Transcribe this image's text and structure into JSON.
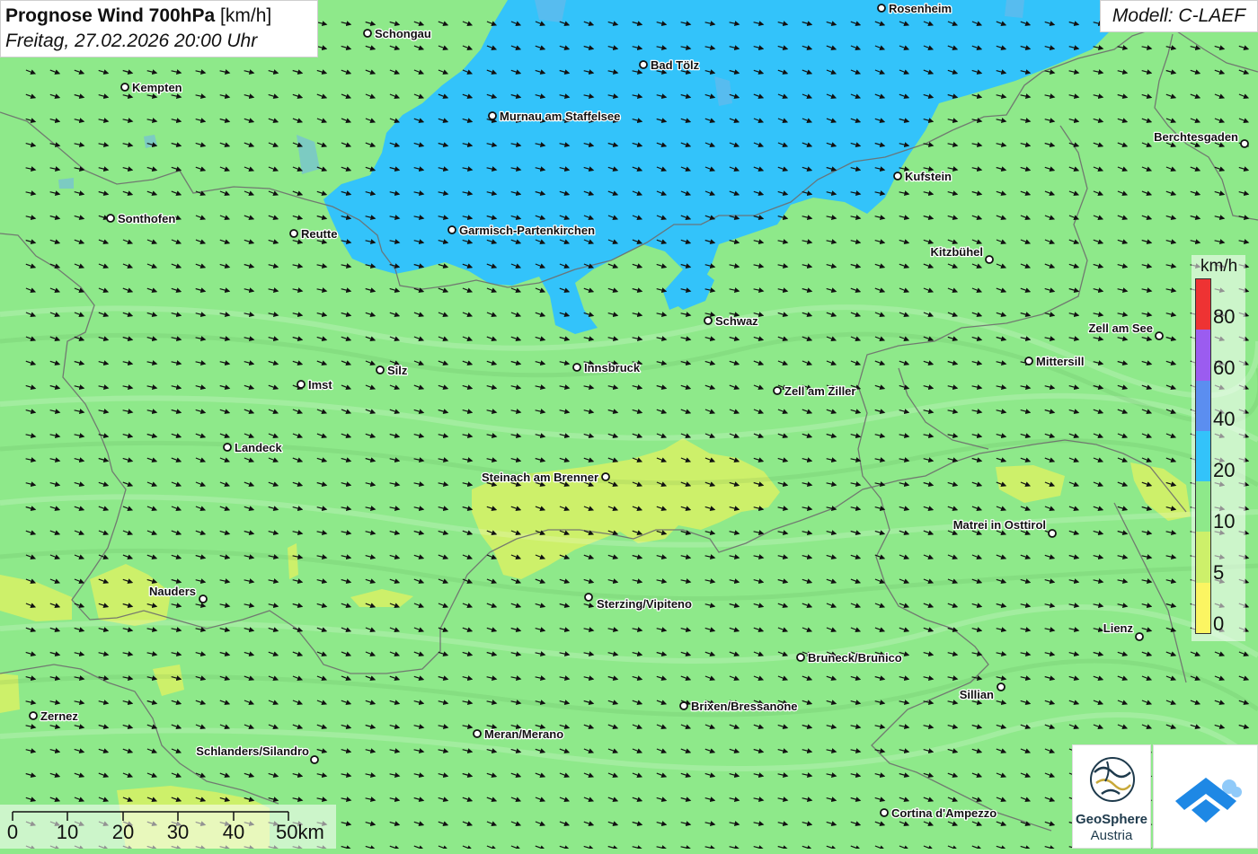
{
  "header": {
    "title_bold": "Prognose Wind 700hPa",
    "title_unit": "[km/h]",
    "subtitle": "Freitag, 27.02.2026 20:00 Uhr",
    "model": "Modell: C-LAEF"
  },
  "legend": {
    "unit": "km/h",
    "segments": [
      {
        "color": "#ee3333"
      },
      {
        "color": "#9b5cf0"
      },
      {
        "color": "#5b8ef0"
      },
      {
        "color": "#33c3fa"
      },
      {
        "color": "#8ee98a"
      },
      {
        "color": "#cdf06a"
      },
      {
        "color": "#fbf562"
      }
    ],
    "ticks": [
      "80",
      "60",
      "40",
      "20",
      "10",
      "5",
      "0"
    ]
  },
  "scale_bar": {
    "ticks": [
      "0",
      "10",
      "20",
      "30",
      "40",
      "50km"
    ]
  },
  "cities": [
    {
      "id": "rosenheim",
      "name": "Rosenheim",
      "label_side": "right"
    },
    {
      "id": "schongau",
      "name": "Schongau",
      "label_side": "right"
    },
    {
      "id": "bad-toelz",
      "name": "Bad Tölz",
      "label_side": "right"
    },
    {
      "id": "kempten",
      "name": "Kempten",
      "label_side": "right"
    },
    {
      "id": "murnau",
      "name": "Murnau am Staffelsee",
      "label_side": "right"
    },
    {
      "id": "berchtesgaden",
      "name": "Berchtesgaden",
      "label_side": "left"
    },
    {
      "id": "kufstein",
      "name": "Kufstein",
      "label_side": "right"
    },
    {
      "id": "sonthofen",
      "name": "Sonthofen",
      "label_side": "right"
    },
    {
      "id": "reutte",
      "name": "Reutte",
      "label_side": "right"
    },
    {
      "id": "garmisch",
      "name": "Garmisch-Partenkirchen",
      "label_side": "right"
    },
    {
      "id": "kitzbuehel",
      "name": "Kitzbühel",
      "label_side": "left"
    },
    {
      "id": "schwaz",
      "name": "Schwaz",
      "label_side": "right"
    },
    {
      "id": "zell-am-see",
      "name": "Zell am See",
      "label_side": "left"
    },
    {
      "id": "mittersill",
      "name": "Mittersill",
      "label_side": "right"
    },
    {
      "id": "silz",
      "name": "Silz",
      "label_side": "right"
    },
    {
      "id": "innsbruck",
      "name": "Innsbruck",
      "label_side": "right"
    },
    {
      "id": "imst",
      "name": "Imst",
      "label_side": "right"
    },
    {
      "id": "zell-am-ziller",
      "name": "Zell am Ziller",
      "label_side": "right"
    },
    {
      "id": "landeck",
      "name": "Landeck",
      "label_side": "right"
    },
    {
      "id": "steinach",
      "name": "Steinach am Brenner",
      "label_side": "left"
    },
    {
      "id": "matrei",
      "name": "Matrei in Osttirol",
      "label_side": "left"
    },
    {
      "id": "nauders",
      "name": "Nauders",
      "label_side": "left"
    },
    {
      "id": "sterzing",
      "name": "Sterzing/Vipiteno",
      "label_side": "right"
    },
    {
      "id": "lienz",
      "name": "Lienz",
      "label_side": "left"
    },
    {
      "id": "bruneck",
      "name": "Bruneck/Brunico",
      "label_side": "right"
    },
    {
      "id": "sillian",
      "name": "Sillian",
      "label_side": "left"
    },
    {
      "id": "brixen",
      "name": "Brixen/Bressanone",
      "label_side": "right"
    },
    {
      "id": "zernez",
      "name": "Zernez",
      "label_side": "right"
    },
    {
      "id": "meran",
      "name": "Meran/Merano",
      "label_side": "right"
    },
    {
      "id": "schlanders",
      "name": "Schlanders/Silandro",
      "label_side": "left"
    },
    {
      "id": "cortina",
      "name": "Cortina d'Ampezzo",
      "label_side": "right"
    }
  ],
  "logos": {
    "geosphere_line1": "GeoSphere",
    "geosphere_line2": "Austria"
  }
}
